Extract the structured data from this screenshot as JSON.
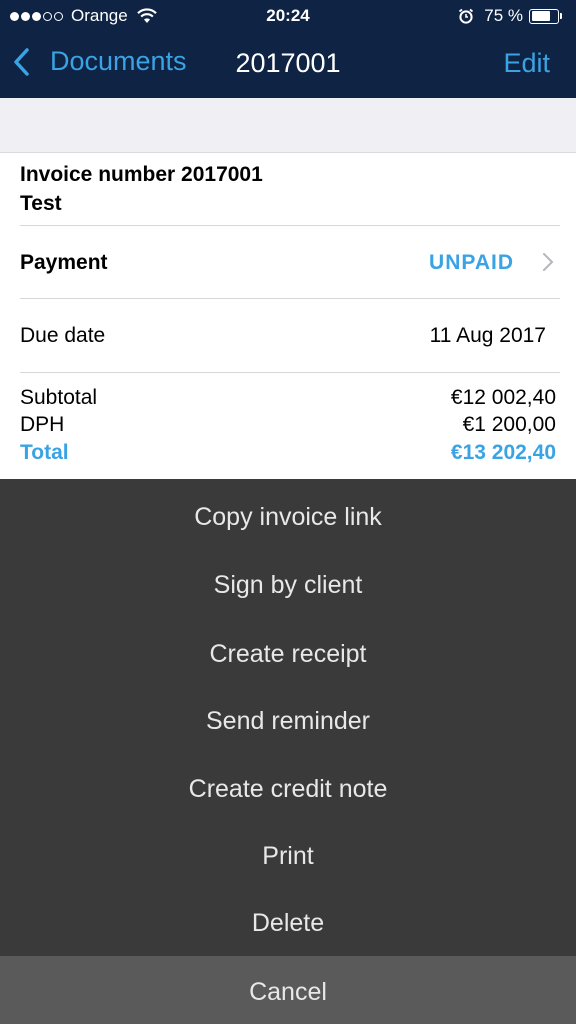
{
  "status_bar": {
    "carrier": "Orange",
    "time": "20:24",
    "battery": "75 %",
    "battery_level": 0.75
  },
  "nav": {
    "back_label": "Documents",
    "title": "2017001",
    "edit_label": "Edit"
  },
  "invoice": {
    "number_line": "Invoice number 2017001",
    "name": "Test",
    "payment_label": "Payment",
    "payment_status": "UNPAID",
    "due_label": "Due date",
    "due_value": "11 Aug 2017",
    "subtotal_label": "Subtotal",
    "subtotal_value": "€12 002,40",
    "tax_label": "DPH",
    "tax_value": "€1 200,00",
    "total_label": "Total",
    "total_value": "€13 202,40"
  },
  "action_sheet": {
    "actions": [
      "Copy invoice link",
      "Sign by client",
      "Create receipt",
      "Send reminder",
      "Create credit note",
      "Print",
      "Delete"
    ],
    "cancel": "Cancel"
  },
  "colors": {
    "nav_bg": "#0f2344",
    "accent": "#3aa3e3",
    "sheet_bg": "#3a3a3a"
  }
}
